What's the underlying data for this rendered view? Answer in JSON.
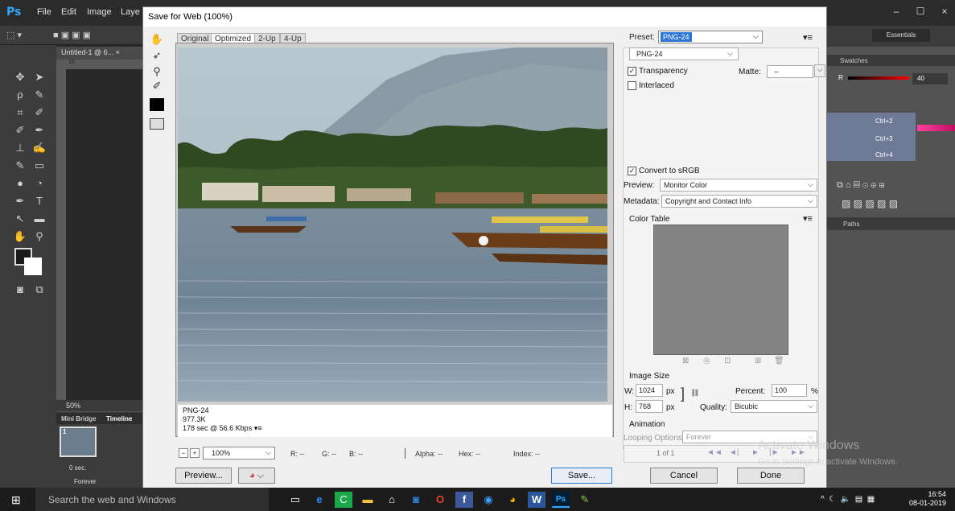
{
  "photoshop": {
    "logo": "Ps",
    "menu": [
      "File",
      "Edit",
      "Image",
      "Laye"
    ],
    "doc_tab": "Untitled-1 @ 6... ×",
    "ruler_mark": "15",
    "zoom": "50%",
    "bottom_tabs": [
      "Mini Bridge",
      "Timeline"
    ],
    "frame_number": "1",
    "frame_delay": "0 sec.",
    "loop": "Forever",
    "essentials": "Essentials",
    "swatches_tab": "Swatches",
    "color_value": "40",
    "shortcuts": [
      "Ctrl+2",
      "Ctrl+3",
      "Ctrl+4"
    ],
    "paths_tab": "Paths",
    "win_controls": [
      "–",
      "☐",
      "×"
    ]
  },
  "dialog": {
    "title": "Save for Web (100%)",
    "view_tabs": [
      "Original",
      "Optimized",
      "2-Up",
      "4-Up"
    ],
    "active_tab": "Optimized",
    "info": {
      "format": "PNG-24",
      "size": "977.3K",
      "time": "178 sec @ 56.6 Kbps"
    },
    "zoom_value": "100%",
    "readouts": {
      "r": "R: --",
      "g": "G: --",
      "b": "B: --",
      "alpha": "Alpha: --",
      "hex": "Hex: --",
      "index": "Index: --"
    },
    "buttons": {
      "preview": "Preview...",
      "save": "Save...",
      "cancel": "Cancel",
      "done": "Done"
    },
    "preset_label": "Preset:",
    "preset_value": "PNG-24",
    "format_value": "PNG-24",
    "transparency_label": "Transparency",
    "transparency_checked": true,
    "matte_label": "Matte:",
    "matte_value": "--",
    "interlaced_label": "Interlaced",
    "interlaced_checked": false,
    "convert_srgb_label": "Convert to sRGB",
    "convert_srgb_checked": true,
    "preview_label": "Preview:",
    "preview_value": "Monitor Color",
    "metadata_label": "Metadata:",
    "metadata_value": "Copyright and Contact Info",
    "color_table_label": "Color Table",
    "image_size_label": "Image Size",
    "width_label": "W:",
    "width_value": "1024",
    "height_label": "H:",
    "height_value": "768",
    "unit": "px",
    "percent_label": "Percent:",
    "percent_value": "100",
    "percent_unit": "%",
    "quality_label": "Quality:",
    "quality_value": "Bicubic",
    "animation_label": "Animation",
    "looping_label": "Looping Options:",
    "looping_value": "Forever",
    "frame_counter": "1 of 1"
  },
  "watermark": {
    "line1": "Activate Windows",
    "line2": "Go to Settings to activate Windows."
  },
  "taskbar": {
    "search_placeholder": "Search the web and Windows",
    "time": "16:54",
    "date": "08-01-2019"
  }
}
